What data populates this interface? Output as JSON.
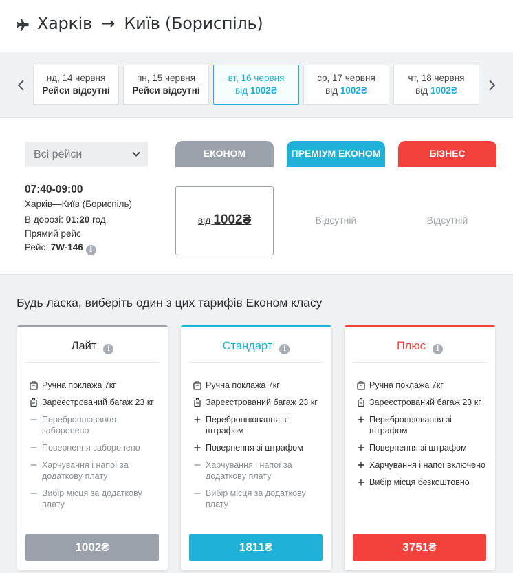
{
  "header": {
    "origin": "Харків",
    "arrow": "→",
    "destination": "Київ (Бориспіль)"
  },
  "dates": [
    {
      "day": "нд, 14 червня",
      "status": "Рейси відсутні",
      "prefix": "",
      "amount": ""
    },
    {
      "day": "пн, 15 червня",
      "status": "Рейси відсутні",
      "prefix": "",
      "amount": ""
    },
    {
      "day": "вт, 16 червня",
      "status": "",
      "prefix": "від ",
      "amount": "1002₴"
    },
    {
      "day": "ср, 17 червня",
      "status": "",
      "prefix": "від ",
      "amount": "1002₴"
    },
    {
      "day": "чт, 18 червня",
      "status": "",
      "prefix": "від ",
      "amount": "1002₴"
    }
  ],
  "filter": {
    "label": "Всі рейси"
  },
  "classes": {
    "econom": "ЕКОНОМ",
    "premium": "ПРЕМІУМ ЕКОНОМ",
    "business": "БІЗНЕС"
  },
  "flight": {
    "time": "07:40-09:00",
    "route": "Харків—Київ (Бориспіль)",
    "duration_label": "В дорозі: ",
    "duration_value": "01:20",
    "duration_unit": " год.",
    "type": "Прямий рейс",
    "number_label": "Рейс: ",
    "number_value": "7W-146",
    "info": "i"
  },
  "prices": {
    "econom_prefix": "від ",
    "econom_amount": "1002₴",
    "premium": "Відсутній",
    "business": "Відсутній"
  },
  "tariffs": {
    "heading": "Будь ласка, виберіть один з цих тарифів Економ класу",
    "cards": [
      {
        "name": "Лайт",
        "price": "1002₴",
        "features": [
          {
            "icon": "bag-icon",
            "text": "Ручна поклажа 7кг"
          },
          {
            "icon": "luggage-icon",
            "text": "Зареєстрований багаж 23 кг"
          },
          {
            "icon": "minus-icon",
            "text": "Переброннювання заборонено"
          },
          {
            "icon": "minus-icon",
            "text": "Повернення заборонено"
          },
          {
            "icon": "minus-icon",
            "text": "Харчування і напої за додатковy плату"
          },
          {
            "icon": "minus-icon",
            "text": "Вибір місця за додаткову плату"
          }
        ]
      },
      {
        "name": "Стандарт",
        "price": "1811₴",
        "features": [
          {
            "icon": "bag-icon",
            "text": "Ручна поклажа 7кг"
          },
          {
            "icon": "luggage-icon",
            "text": "Зареєстрований багаж 23 кг"
          },
          {
            "icon": "plus-icon",
            "text": "Переброннювання зі штрафом"
          },
          {
            "icon": "plus-icon",
            "text": "Повернення зі штрафом"
          },
          {
            "icon": "minus-icon",
            "text": "Харчування і напої за додатковy плату"
          },
          {
            "icon": "minus-icon",
            "text": "Вибір місця за додаткову плату"
          }
        ]
      },
      {
        "name": "Плюс",
        "price": "3751₴",
        "features": [
          {
            "icon": "bag-icon",
            "text": "Ручна поклажа 7кг"
          },
          {
            "icon": "luggage-icon",
            "text": "Зареєстрований багаж 23 кг"
          },
          {
            "icon": "plus-icon",
            "text": "Переброннювання зі штрафом"
          },
          {
            "icon": "plus-icon",
            "text": "Повернення зі штрафом"
          },
          {
            "icon": "plus-icon",
            "text": "Харчування і напої включено"
          },
          {
            "icon": "plus-icon",
            "text": "Вибір місця безкоштовно"
          }
        ]
      }
    ]
  },
  "colors": {
    "grey": "#9aa1aa",
    "blue": "#1fb1d8",
    "red": "#f4413b"
  }
}
